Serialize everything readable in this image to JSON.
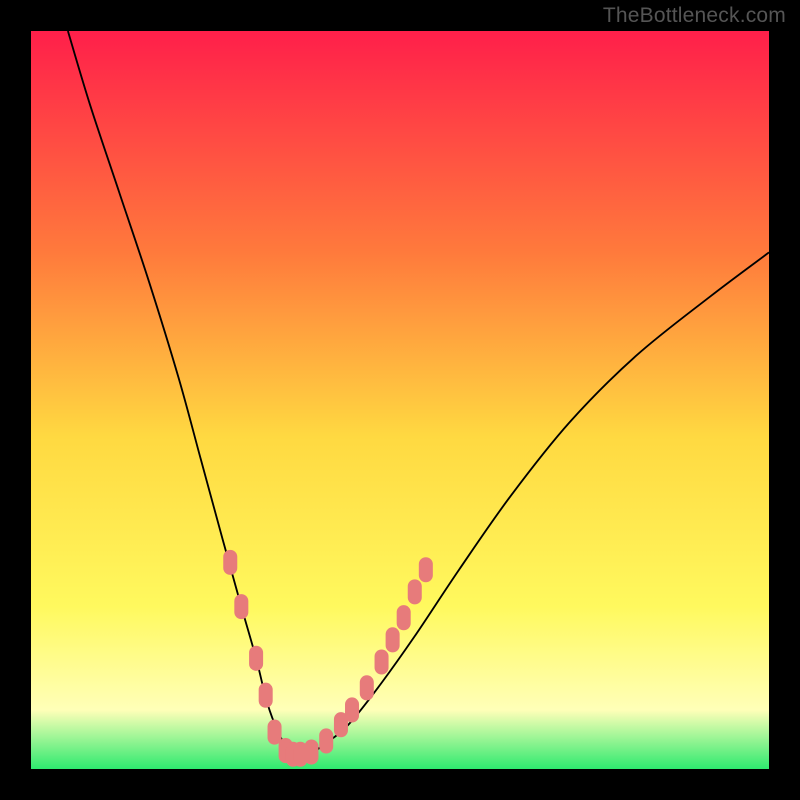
{
  "watermark": "TheBottleneck.com",
  "colors": {
    "frame": "#000000",
    "gradient_top": "#ff1f4a",
    "gradient_mid1": "#ff7a3c",
    "gradient_mid2": "#ffd941",
    "gradient_mid3": "#fff95e",
    "gradient_mid4": "#ffffb8",
    "gradient_bottom": "#2eea6f",
    "curve": "#000000",
    "marker_fill": "#e77b7b",
    "marker_stroke": "#e77b7b"
  },
  "chart_data": {
    "type": "line",
    "title": "",
    "xlabel": "",
    "ylabel": "",
    "xlim": [
      0,
      100
    ],
    "ylim": [
      0,
      100
    ],
    "series": [
      {
        "name": "bottleneck-curve",
        "x": [
          5,
          8,
          12,
          16,
          20,
          23,
          26,
          28.5,
          30.5,
          32,
          33.5,
          35,
          36.5,
          38,
          40,
          43,
          47,
          52,
          58,
          65,
          73,
          82,
          92,
          100
        ],
        "y": [
          100,
          90,
          78,
          66,
          53,
          42,
          31,
          22,
          15,
          9,
          5,
          2.5,
          2,
          2.2,
          3.5,
          6,
          11,
          18,
          27,
          37,
          47,
          56,
          64,
          70
        ]
      }
    ],
    "markers": [
      {
        "x": 27,
        "y": 28
      },
      {
        "x": 28.5,
        "y": 22
      },
      {
        "x": 30.5,
        "y": 15
      },
      {
        "x": 31.8,
        "y": 10
      },
      {
        "x": 33,
        "y": 5
      },
      {
        "x": 34.5,
        "y": 2.5
      },
      {
        "x": 35.5,
        "y": 2
      },
      {
        "x": 36.5,
        "y": 2
      },
      {
        "x": 38,
        "y": 2.3
      },
      {
        "x": 40,
        "y": 3.8
      },
      {
        "x": 42,
        "y": 6
      },
      {
        "x": 43.5,
        "y": 8
      },
      {
        "x": 45.5,
        "y": 11
      },
      {
        "x": 47.5,
        "y": 14.5
      },
      {
        "x": 49,
        "y": 17.5
      },
      {
        "x": 50.5,
        "y": 20.5
      },
      {
        "x": 52,
        "y": 24
      },
      {
        "x": 53.5,
        "y": 27
      }
    ]
  }
}
